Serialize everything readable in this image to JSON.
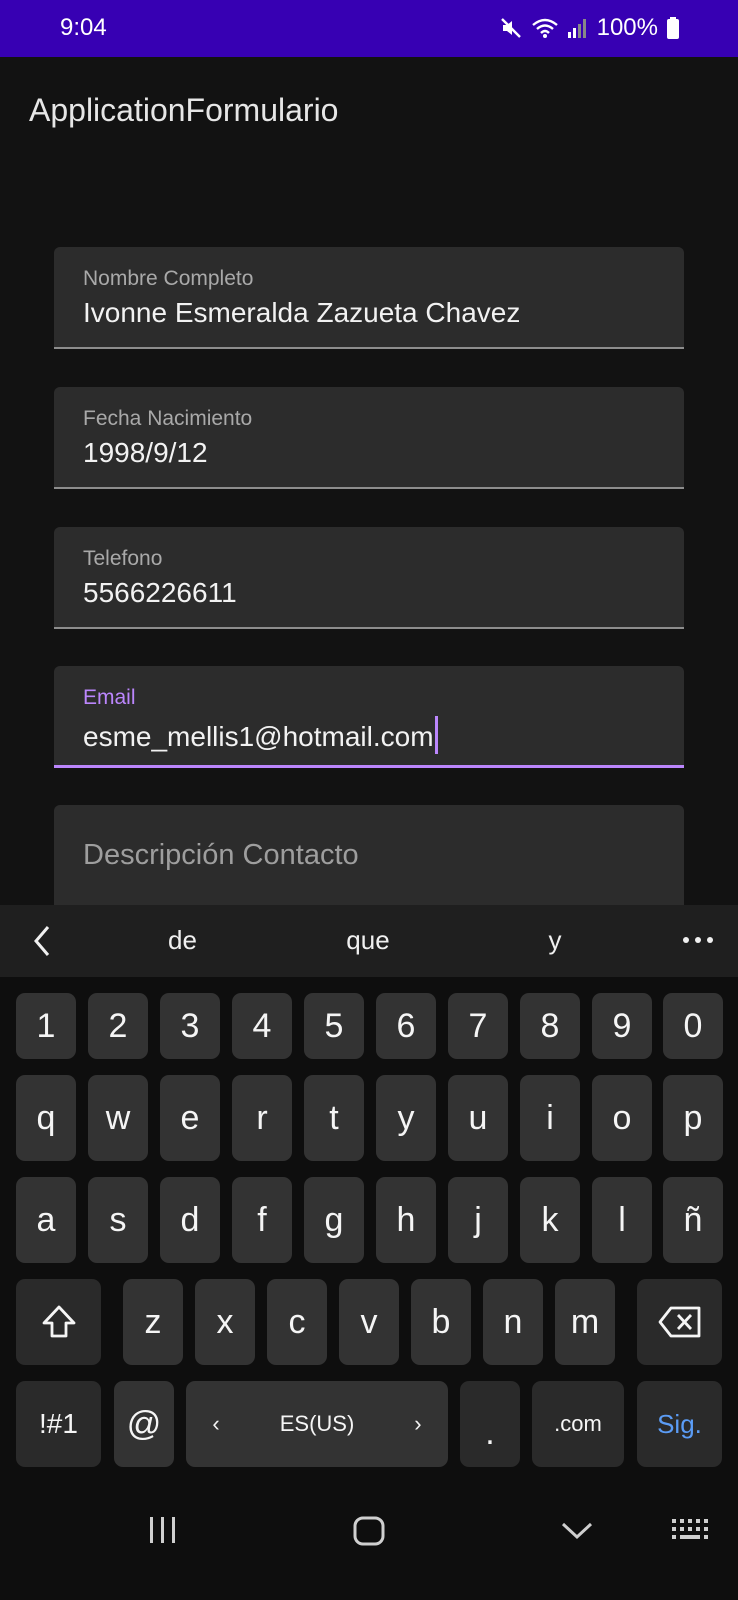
{
  "status_bar": {
    "time": "9:04",
    "battery_text": "100%",
    "icons": [
      "mute-icon",
      "wifi-icon",
      "signal-icon",
      "battery-icon"
    ]
  },
  "app_bar": {
    "title": "ApplicationFormulario"
  },
  "form": {
    "nombre": {
      "label": "Nombre Completo",
      "value": "Ivonne Esmeralda Zazueta Chavez"
    },
    "fecha": {
      "label": "Fecha Nacimiento",
      "value": "1998/9/12"
    },
    "telefono": {
      "label": "Telefono",
      "value": "5566226611"
    },
    "email": {
      "label": "Email",
      "value": "esme_mellis1@hotmail.com",
      "focused": true
    },
    "descripcion": {
      "placeholder": "Descripción Contacto"
    }
  },
  "keyboard": {
    "suggestions": [
      "de",
      "que",
      "y"
    ],
    "rows": {
      "numbers": [
        "1",
        "2",
        "3",
        "4",
        "5",
        "6",
        "7",
        "8",
        "9",
        "0"
      ],
      "row1": [
        "q",
        "w",
        "e",
        "r",
        "t",
        "y",
        "u",
        "i",
        "o",
        "p"
      ],
      "row2": [
        "a",
        "s",
        "d",
        "f",
        "g",
        "h",
        "j",
        "k",
        "l",
        "ñ"
      ],
      "row3": [
        "z",
        "x",
        "c",
        "v",
        "b",
        "n",
        "m"
      ]
    },
    "symbols_key": "!#1",
    "at_key": "@",
    "language": "ES(US)",
    "period_key": ".",
    "dotcom_key": ".com",
    "action_key": "Sig."
  },
  "nav_bar": {
    "icons": [
      "recents-icon",
      "home-icon",
      "back-icon",
      "keyboard-icon"
    ]
  },
  "colors": {
    "status_bar": "#3700b3",
    "accent": "#bb86fc",
    "background": "#121212",
    "action_blue": "#5b9cf5"
  }
}
